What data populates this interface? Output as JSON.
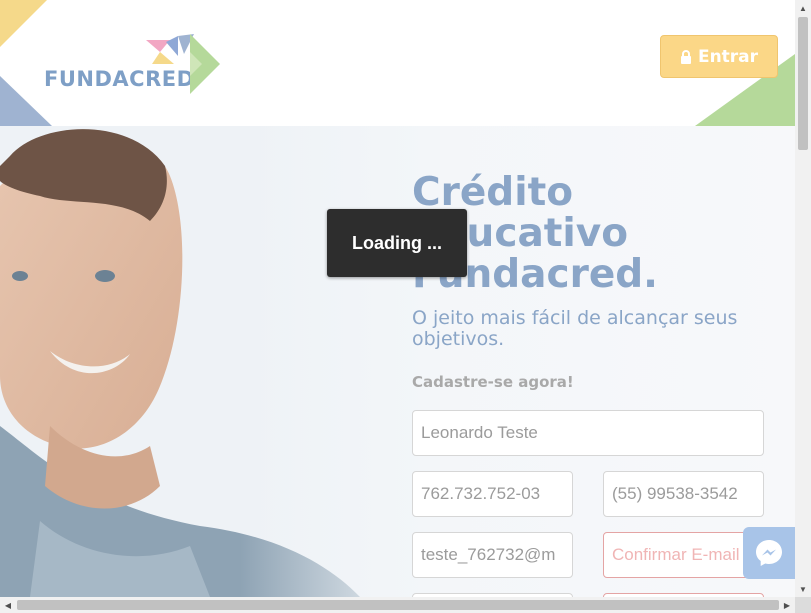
{
  "header": {
    "logo_text": "FUNDACRED",
    "login_button": "Entrar",
    "colors": {
      "yellow": "#f5d98a",
      "blue": "#9fb3d1",
      "green": "#b5d99a",
      "button": "#fbd787"
    }
  },
  "hero": {
    "title_lines": [
      "Crédito",
      "Educativo",
      "Fundacred."
    ],
    "subtitle": "O jeito mais fácil de alcançar seus objetivos.",
    "cta": "Cadastre-se agora!"
  },
  "form": {
    "name_value": "Leonardo Teste",
    "cpf_value": "762.732.752-03",
    "phone_value": "(55) 99538-3542",
    "email_value": "teste_762732@m",
    "confirm_email_placeholder": "Confirmar E-mail"
  },
  "overlay": {
    "loading_text": "Loading ..."
  },
  "icons": {
    "lock": "lock-icon",
    "messenger": "messenger-icon"
  }
}
